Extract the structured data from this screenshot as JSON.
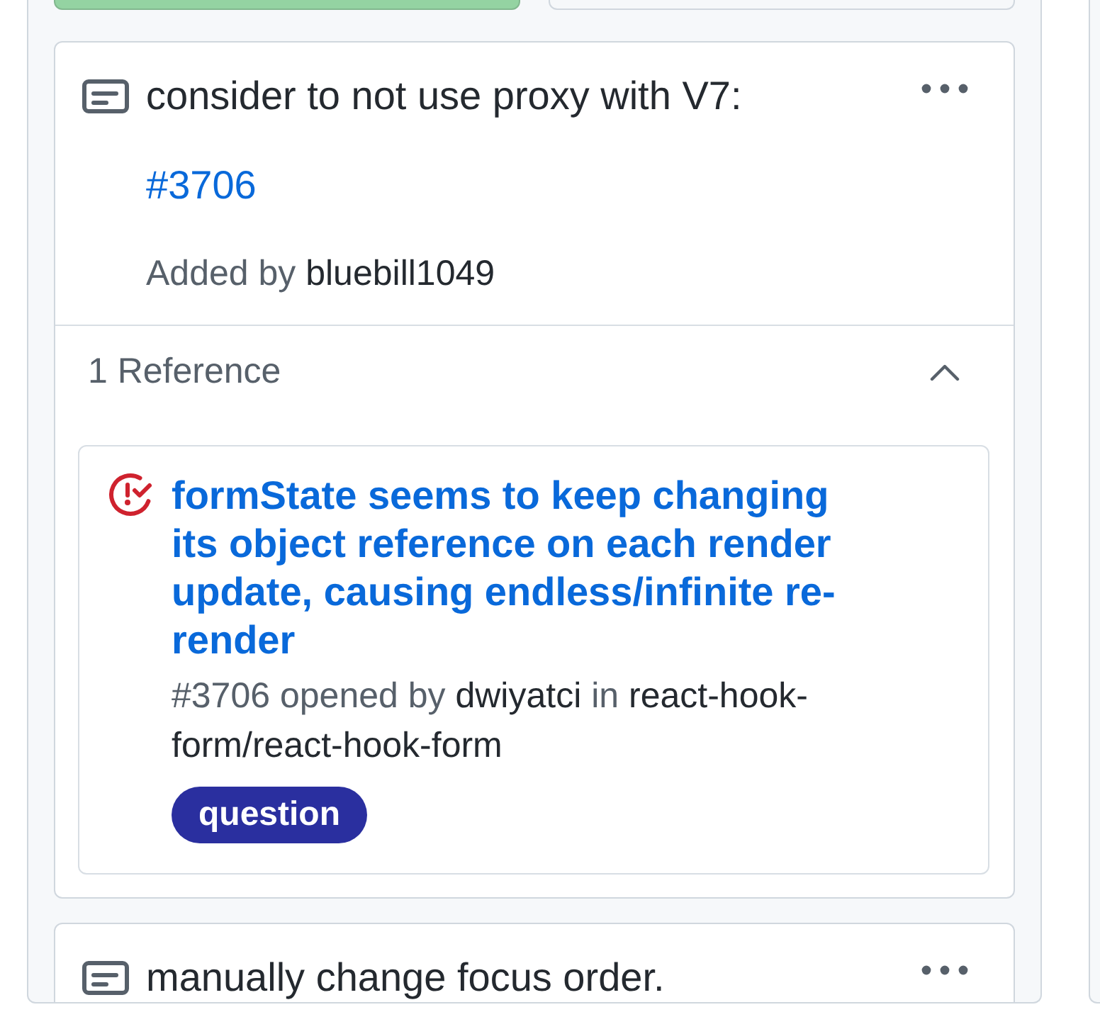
{
  "form_buttons": [
    {
      "kind": "primary",
      "disabled": true
    },
    {
      "kind": "secondary",
      "disabled": false
    }
  ],
  "cards": [
    {
      "kind": "note",
      "text": "consider to not use proxy with V7:",
      "link": "#3706",
      "added_by_label": "Added by",
      "author": "bluebill1049",
      "references_label": "1 Reference",
      "expanded": true,
      "references": [
        {
          "kind": "issue",
          "title": "formState seems to keep changing its object reference on each render update, causing endless/infinite re-render",
          "number": "#3706",
          "opened_label": "opened by",
          "author": "dwiyatci",
          "in_label": "in",
          "repo": "react-hook-form/react-hook-form",
          "labels": [
            {
              "name": "question",
              "color": "#2a2f9f"
            }
          ]
        }
      ]
    },
    {
      "kind": "note",
      "text": "manually change focus order."
    }
  ]
}
